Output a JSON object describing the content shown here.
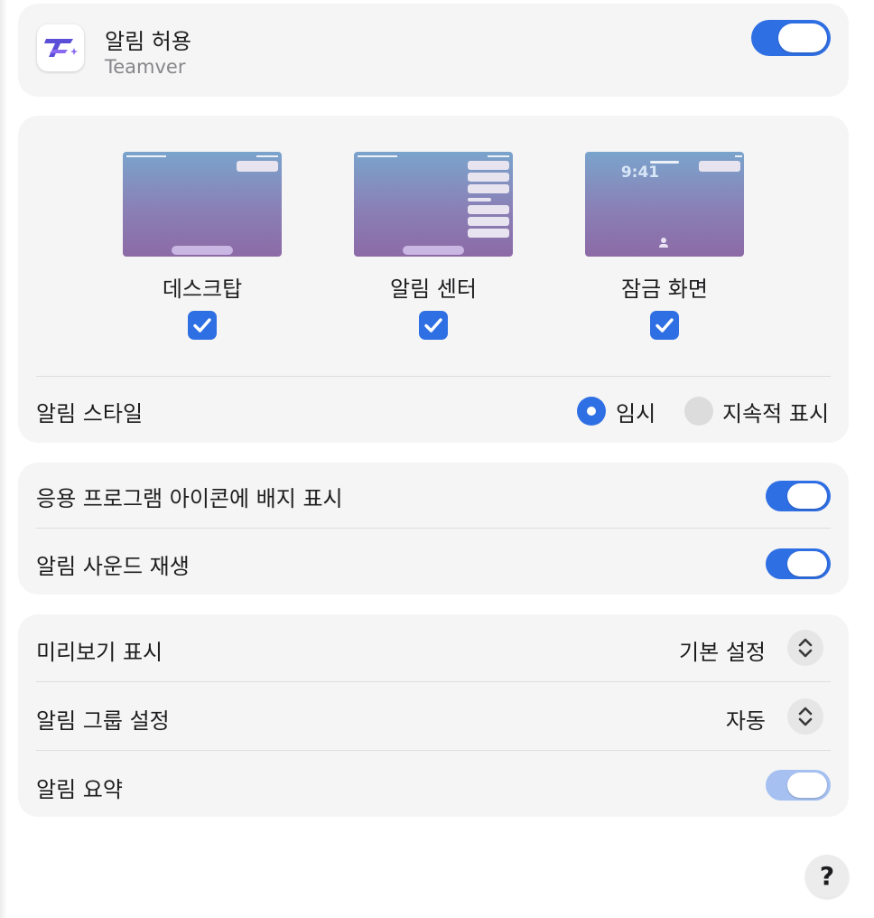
{
  "header": {
    "title": "알림 허용",
    "app_name": "Teamver",
    "allow_enabled": true
  },
  "alerts": {
    "options": [
      {
        "label": "데스크탑",
        "checked": true
      },
      {
        "label": "알림 센터",
        "checked": true
      },
      {
        "label": "잠금 화면",
        "checked": true
      }
    ],
    "lock_time": "9:41",
    "style_label": "알림 스타일",
    "style_options": [
      {
        "label": "임시",
        "selected": true
      },
      {
        "label": "지속적 표시",
        "selected": false
      }
    ]
  },
  "toggles": {
    "badge_label": "응용 프로그램 아이콘에 배지 표시",
    "badge_on": true,
    "sound_label": "알림 사운드 재생",
    "sound_on": true
  },
  "prefs": {
    "preview_label": "미리보기 표시",
    "preview_value": "기본 설정",
    "grouping_label": "알림 그룹 설정",
    "grouping_value": "자동",
    "summary_label": "알림 요약",
    "summary_on": true
  },
  "help_label": "?",
  "colors": {
    "accent": "#2f6fe4",
    "card": "#f5f5f5",
    "accent_dim": "#a6c1f1"
  }
}
